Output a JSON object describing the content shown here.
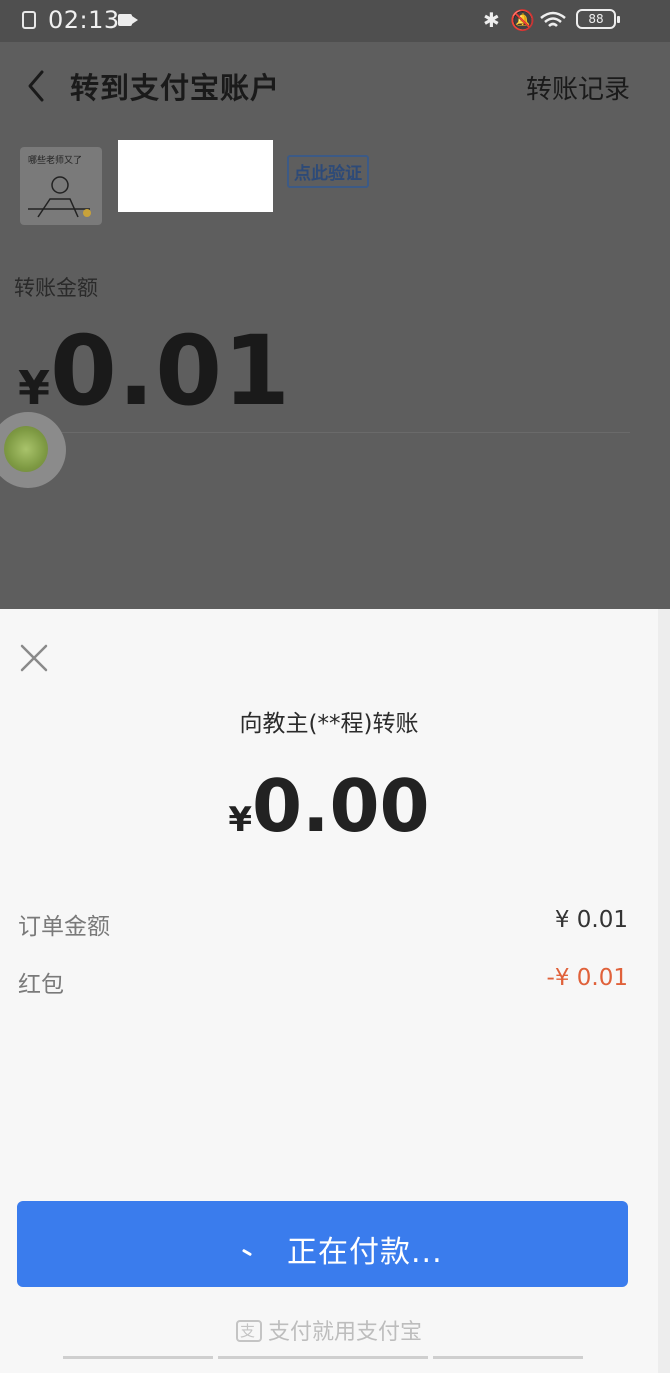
{
  "status_bar": {
    "time": "02:13",
    "battery": "88"
  },
  "nav": {
    "title": "转到支付宝账户",
    "right_link": "转账记录"
  },
  "recipient": {
    "avatar_caption": "哪些老师又了",
    "verify_badge": "点此验证"
  },
  "transfer": {
    "label": "转账金额",
    "currency": "¥",
    "amount": "0.01"
  },
  "sheet": {
    "title": "向教主(**程)转账",
    "currency": "¥",
    "amount": "0.00",
    "rows": [
      {
        "label": "订单金额",
        "value": "¥ 0.01"
      },
      {
        "label": "红包",
        "value": "-¥ 0.01"
      }
    ],
    "button_label": "正在付款...",
    "footer": "支付就用支付宝"
  },
  "colors": {
    "accent": "#3a7ced",
    "discount": "#e0613a"
  }
}
